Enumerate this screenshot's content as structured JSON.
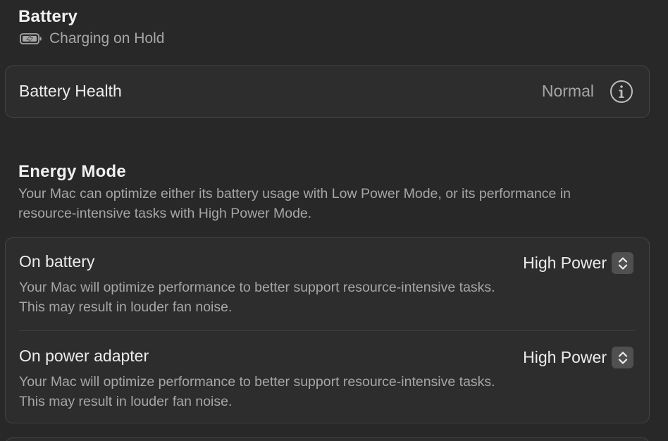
{
  "battery": {
    "title": "Battery",
    "status_icon": "battery-charging-icon",
    "status_text": "Charging on Hold"
  },
  "health": {
    "label": "Battery Health",
    "value": "Normal",
    "info_icon": "info-icon"
  },
  "energy_mode": {
    "title": "Energy Mode",
    "description": "Your Mac can optimize either its battery usage with Low Power Mode, or its performance in resource-intensive tasks with High Power Mode.",
    "rows": [
      {
        "label": "On battery",
        "value": "High Power",
        "description": "Your Mac will optimize performance to better support resource-intensive tasks. This may result in louder fan noise."
      },
      {
        "label": "On power adapter",
        "value": "High Power",
        "description": "Your Mac will optimize performance to better support resource-intensive tasks. This may result in louder fan noise."
      }
    ]
  },
  "colors": {
    "background": "#282828",
    "card": "#2d2d2d",
    "border": "#444444",
    "primary_text": "#ececec",
    "secondary_text": "#a6a6a6",
    "stepper": "#505050"
  }
}
